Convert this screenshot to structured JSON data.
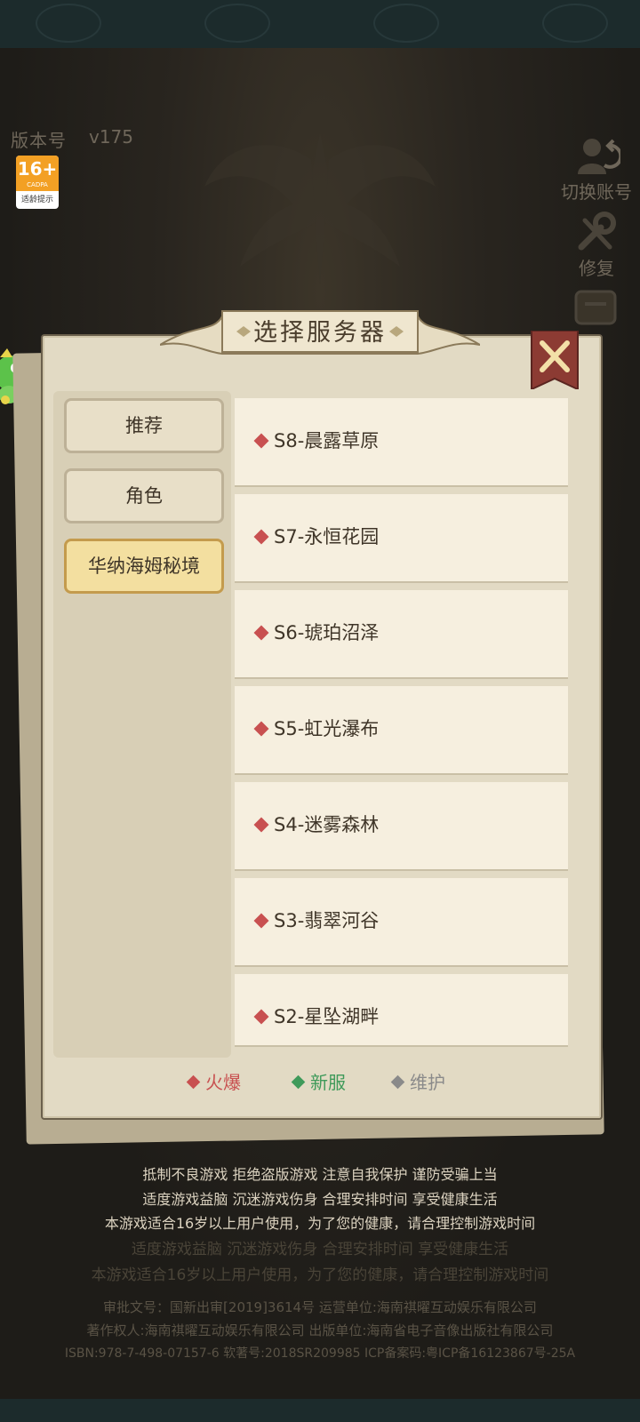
{
  "header": {
    "version_label": "版本号",
    "version_value": "v175"
  },
  "age_rating": {
    "age": "16+",
    "org": "CADPA",
    "caption": "适龄提示"
  },
  "side_buttons": {
    "switch_account": "切换账号",
    "repair": "修复"
  },
  "dialog": {
    "title": "选择服务器",
    "tabs": [
      {
        "label": "推荐"
      },
      {
        "label": "角色"
      },
      {
        "label": "华纳海姆秘境"
      }
    ],
    "servers": [
      {
        "name": "S8-晨露草原",
        "status": "火爆"
      },
      {
        "name": "S7-永恒花园",
        "status": "火爆"
      },
      {
        "name": "S6-琥珀沼泽",
        "status": "火爆"
      },
      {
        "name": "S5-虹光瀑布",
        "status": "火爆"
      },
      {
        "name": "S4-迷雾森林",
        "status": "火爆"
      },
      {
        "name": "S3-翡翠河谷",
        "status": "火爆"
      },
      {
        "name": "S2-星坠湖畔",
        "status": "火爆"
      }
    ],
    "legend": [
      {
        "label": "火爆",
        "color": "#c85050"
      },
      {
        "label": "新服",
        "color": "#3f9a5a"
      },
      {
        "label": "维护",
        "color": "#8a8a8a"
      }
    ]
  },
  "notice": {
    "line1": "抵制不良游戏   拒绝盗版游戏   注意自我保护   谨防受骗上当",
    "line2": "适度游戏益脑   沉迷游戏伤身   合理安排时间   享受健康生活",
    "line3": "本游戏适合16岁以上用户使用，为了您的健康，请合理控制游戏时间",
    "line4": "适度游戏益脑   沉迷游戏伤身   合理安排时间   享受健康生活",
    "line5": "本游戏适合16岁以上用户使用，为了您的健康，请合理控制游戏时间"
  },
  "copyright": {
    "line1": "审批文号：国新出审[2019]3614号 运营单位:海南祺曜互动娱乐有限公司",
    "line2": "著作权人:海南祺曜互动娱乐有限公司 出版单位:海南省电子音像出版社有限公司",
    "line3": "ISBN:978-7-498-07157-6 软著号:2018SR209985 ICP备案码:粤ICP备16123867号-25A"
  },
  "colors": {
    "hot": "#c85050",
    "new": "#3f9a5a",
    "maintenance": "#8a8a8a",
    "panel": "#e2dac4",
    "active_tab": "#f3dfa0"
  }
}
